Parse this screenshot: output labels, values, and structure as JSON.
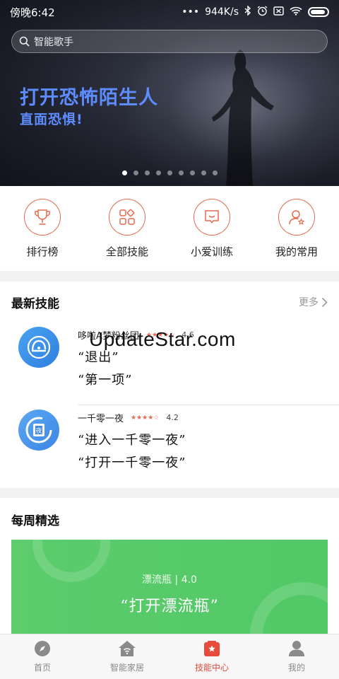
{
  "status_bar": {
    "time": "傍晚6:42",
    "dots": "•••",
    "net_speed": "944K/s"
  },
  "search": {
    "placeholder": "智能歌手"
  },
  "banner": {
    "title": "打开恐怖陌生人",
    "subtitle": "直面恐惧!",
    "slide_count": 9,
    "active_slide": 0
  },
  "quick_actions": [
    {
      "label": "排行榜",
      "icon": "trophy-icon"
    },
    {
      "label": "全部技能",
      "icon": "apps-grid-icon"
    },
    {
      "label": "小爱训练",
      "icon": "chat-bubble-icon"
    },
    {
      "label": "我的常用",
      "icon": "user-star-icon"
    }
  ],
  "newest": {
    "title": "最新技能",
    "more": "更多",
    "skills": [
      {
        "name": "哆啦A梦粉丝团",
        "stars": "★★★★☆",
        "rating": "4.6",
        "phrases": [
          "“退出”",
          "“第一项”"
        ]
      },
      {
        "name": "一千零一夜",
        "stars": "★★★★☆",
        "rating": "4.2",
        "phrases": [
          "“进入一千零一夜”",
          "“打开一千零一夜”"
        ]
      }
    ]
  },
  "watermark": "UpdateStar.com",
  "weekly": {
    "title": "每周精选",
    "card_sub": "漂流瓶 | 4.0",
    "card_title": "“打开漂流瓶”"
  },
  "bottom_nav": [
    {
      "label": "首页",
      "icon": "compass-icon"
    },
    {
      "label": "智能家居",
      "icon": "smart-home-icon"
    },
    {
      "label": "技能中心",
      "icon": "skill-center-icon",
      "active": true
    },
    {
      "label": "我的",
      "icon": "profile-icon"
    }
  ],
  "colors": {
    "accent": "#e8694f",
    "nav_active": "#e84a3c",
    "banner_text": "#5d8cff",
    "card_green": "#5ccc6d"
  }
}
